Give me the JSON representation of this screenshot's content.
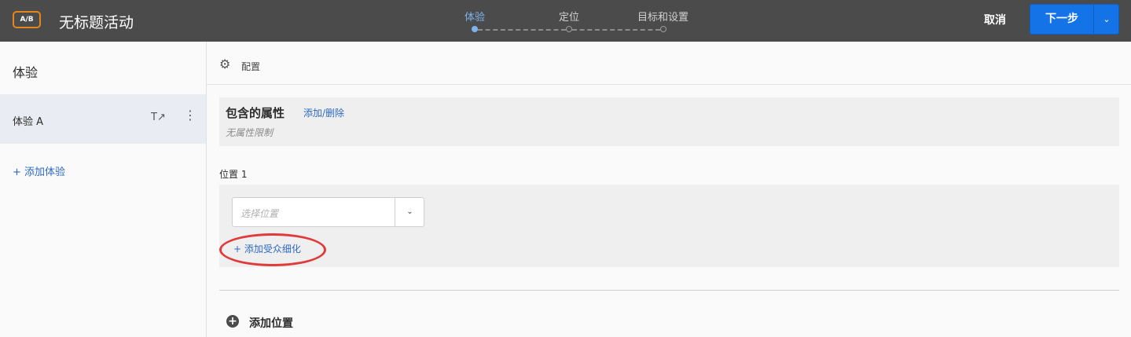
{
  "header": {
    "badge": "A/B",
    "title": "无标题活动",
    "steps": [
      {
        "label": "体验",
        "active": true
      },
      {
        "label": "定位",
        "active": false
      },
      {
        "label": "目标和设置",
        "active": false
      }
    ],
    "cancel": "取消",
    "next": "下一步",
    "next_caret": "⌄"
  },
  "sidebar": {
    "title": "体验",
    "experience": {
      "label": "体验 A",
      "rename_icon": "T↗",
      "more_icon": "⋮"
    },
    "add_label": "+ 添加体验"
  },
  "main": {
    "config_icon": "⚙",
    "config_label": "配置",
    "attributes": {
      "title": "包含的属性",
      "link": "添加/删除",
      "subtitle": "无属性限制"
    },
    "location": {
      "label": "位置 1",
      "placeholder": "选择位置",
      "caret": "⌄",
      "refine_link": "+ 添加受众细化"
    },
    "add_location": "添加位置",
    "add_location_icon": "+"
  },
  "colors": {
    "topbar": "#4b4b4b",
    "accent": "#1473e6",
    "link": "#2d69c4",
    "highlight": "#e03a3a"
  }
}
